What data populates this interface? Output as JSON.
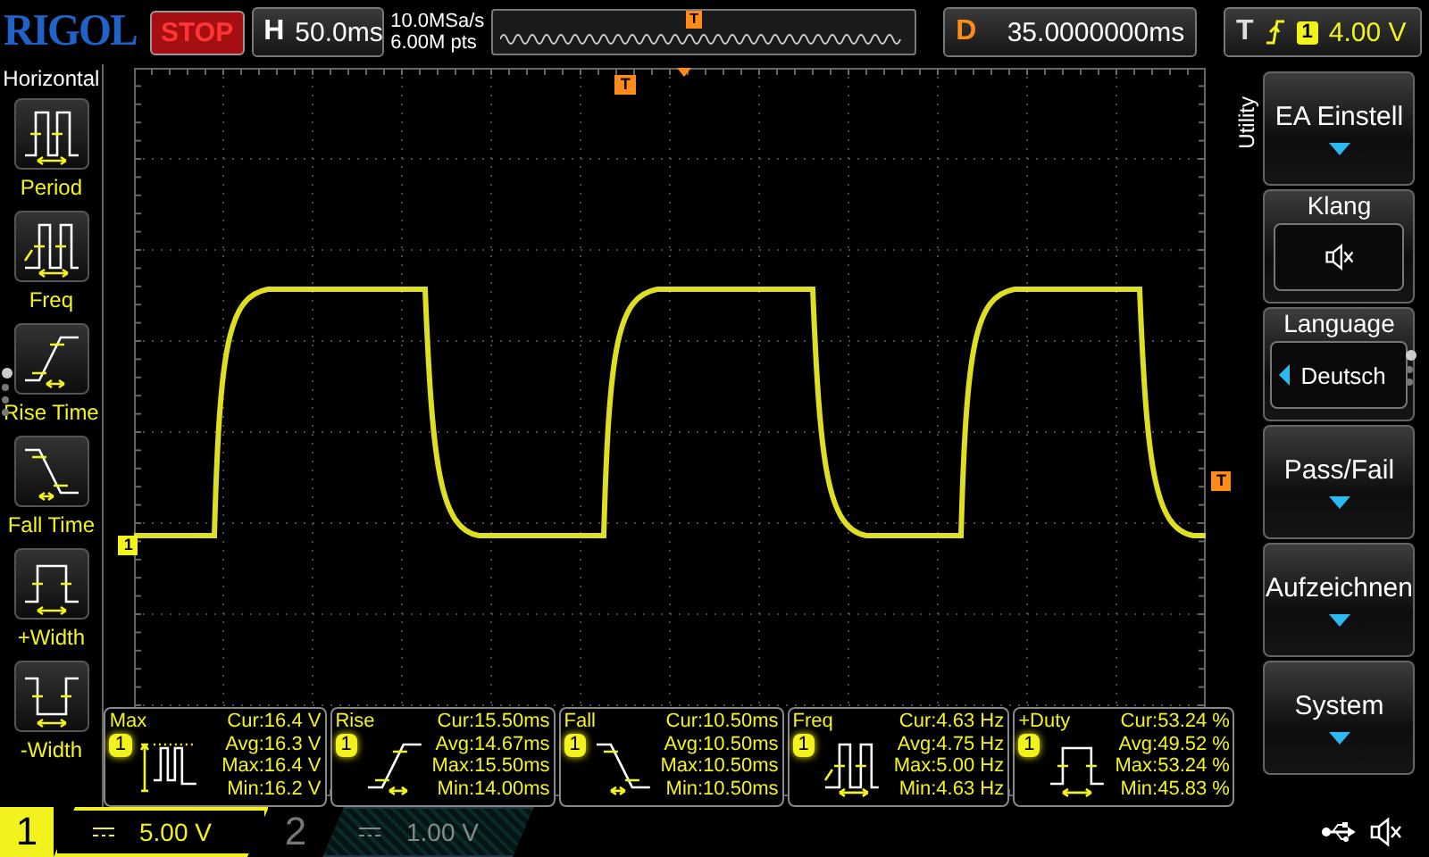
{
  "brand": "RIGOL",
  "run_state": "STOP",
  "timebase": {
    "label": "H",
    "value": "50.0ms"
  },
  "sampling": {
    "rate": "10.0MSa/s",
    "depth": "6.00M pts"
  },
  "overview_marker": "T",
  "delay": {
    "label": "D",
    "value": "35.0000000ms"
  },
  "trigger": {
    "label": "T",
    "source": "1",
    "level": "4.00 V"
  },
  "left_menu": {
    "title": "Horizontal",
    "items": [
      {
        "kind": "period",
        "label": "Period"
      },
      {
        "kind": "freq",
        "label": "Freq"
      },
      {
        "kind": "rise",
        "label": "Rise Time"
      },
      {
        "kind": "fall",
        "label": "Fall Time"
      },
      {
        "kind": "pwidth",
        "label": "+Width"
      },
      {
        "kind": "nwidth",
        "label": "-Width"
      }
    ],
    "pages": [
      {
        "selected": true
      },
      {
        "selected": false
      },
      {
        "selected": false
      },
      {
        "selected": false
      }
    ]
  },
  "screen": {
    "position_marker": "T",
    "channel_marker": "1",
    "level_marker": "T"
  },
  "measurements": [
    {
      "kind": "max",
      "name": "Max",
      "channel": "1",
      "lines": [
        "Cur:16.4 V",
        "Avg:16.3 V",
        "Max:16.4 V",
        "Min:16.2 V"
      ]
    },
    {
      "kind": "rise",
      "name": "Rise",
      "channel": "1",
      "lines": [
        "Cur:15.50ms",
        "Avg:14.67ms",
        "Max:15.50ms",
        "Min:14.00ms"
      ]
    },
    {
      "kind": "fall",
      "name": "Fall",
      "channel": "1",
      "lines": [
        "Cur:10.50ms",
        "Avg:10.50ms",
        "Max:10.50ms",
        "Min:10.50ms"
      ]
    },
    {
      "kind": "freq",
      "name": "Freq",
      "channel": "1",
      "lines": [
        "Cur:4.63 Hz",
        "Avg:4.75 Hz",
        "Max:5.00 Hz",
        "Min:4.63 Hz"
      ]
    },
    {
      "kind": "duty",
      "name": "+Duty",
      "channel": "1",
      "lines": [
        "Cur:53.24 %",
        "Avg:49.52 %",
        "Max:53.24 %",
        "Min:45.83 %"
      ]
    }
  ],
  "right_menu": {
    "title": "Utility",
    "items": [
      {
        "kind": "submenu",
        "label": "EA Einstell"
      },
      {
        "kind": "sound",
        "label": "Klang",
        "muted": true
      },
      {
        "kind": "select",
        "label": "Language",
        "value": "Deutsch"
      },
      {
        "kind": "submenu",
        "label": "Pass/Fail"
      },
      {
        "kind": "submenu",
        "label": "Aufzeichnen"
      },
      {
        "kind": "submenu",
        "label": "System"
      }
    ],
    "pages": [
      {
        "selected": true
      },
      {
        "selected": false
      },
      {
        "selected": false
      }
    ]
  },
  "channels": [
    {
      "number": "1",
      "scale": "5.00 V",
      "selected": true
    },
    {
      "number": "2",
      "scale": "1.00 V",
      "selected": false
    }
  ],
  "status": {
    "sound_muted": true
  }
}
